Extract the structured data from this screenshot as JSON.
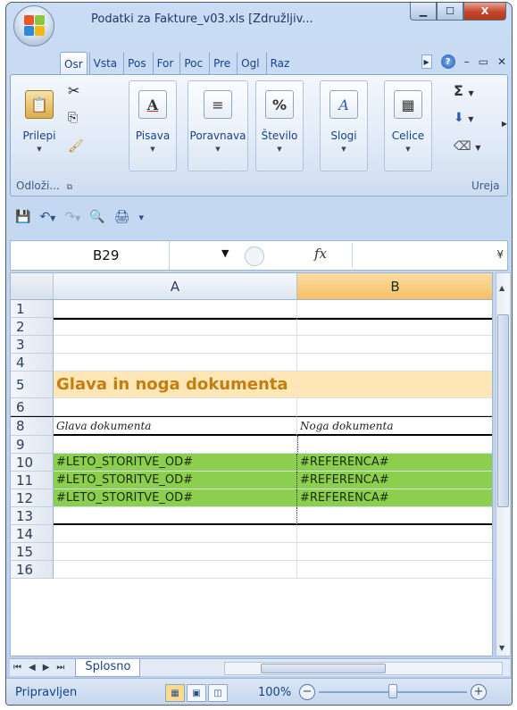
{
  "window": {
    "title": "Podatki za Fakture_v03.xls  [Združljiv...",
    "controls": {
      "minimize": "▁",
      "maximize": "☐",
      "close": "X"
    }
  },
  "ribbon": {
    "tabs": [
      "Osr",
      "Vsta",
      "Pos",
      "For",
      "Poc",
      "Pre",
      "Ogl",
      "Raz"
    ],
    "groups": {
      "clipboard_label": "Odloži...",
      "paste_label": "Prilepi",
      "font_label": "Pisava",
      "align_label": "Poravnava",
      "number_label": "Število",
      "styles_label": "Slogi",
      "cells_label": "Celice",
      "editing_label": "Ureja"
    }
  },
  "formula_bar": {
    "name_box": "B29",
    "fx": "fx",
    "value": ""
  },
  "sheet": {
    "columns": [
      "A",
      "B"
    ],
    "selected_column": "B",
    "rows": [
      {
        "num": "1",
        "a": "",
        "b": ""
      },
      {
        "num": "2",
        "a": "",
        "b": ""
      },
      {
        "num": "3",
        "a": "",
        "b": ""
      },
      {
        "num": "4",
        "a": "",
        "b": ""
      },
      {
        "num": "5",
        "a": "Glava in noga dokumenta",
        "b": ""
      },
      {
        "num": "6",
        "a": "",
        "b": ""
      },
      {
        "num": "8",
        "a": "Glava dokumenta",
        "b": "Noga dokumenta"
      },
      {
        "num": "9",
        "a": "",
        "b": ""
      },
      {
        "num": "10",
        "a": "#LETO_STORITVE_OD#",
        "b": "#REFERENCA#"
      },
      {
        "num": "11",
        "a": "#LETO_STORITVE_OD#",
        "b": "#REFERENCA#"
      },
      {
        "num": "12",
        "a": "#LETO_STORITVE_OD#",
        "b": "#REFERENCA#"
      },
      {
        "num": "13",
        "a": "",
        "b": ""
      },
      {
        "num": "14",
        "a": "",
        "b": ""
      },
      {
        "num": "15",
        "a": "",
        "b": ""
      },
      {
        "num": "16",
        "a": "",
        "b": ""
      }
    ],
    "tab_name": "Splosno"
  },
  "status": {
    "text": "Pripravljen",
    "zoom": "100%"
  },
  "colors": {
    "title_row_bg": "#fde7b6",
    "title_text": "#c57d12",
    "green_row_bg": "#8ccf4f",
    "selected_col_header": "#f5c165"
  }
}
